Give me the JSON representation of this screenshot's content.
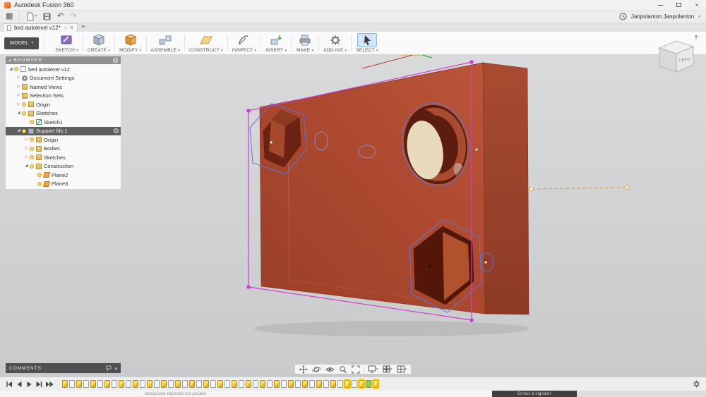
{
  "window": {
    "title": "Autodesk Fusion 360"
  },
  "glyphs": {
    "caret": "▾",
    "caret_up": "▴",
    "close": "×",
    "plus": "+",
    "sync": "○",
    "undo": "↶",
    "redo": "↷",
    "grid_menu": "▦",
    "collapse": "«",
    "expanded": "◢",
    "collapsed": "▷"
  },
  "user": {
    "name": "Janpolanton Janpolanton"
  },
  "tab": {
    "title": "bed autolevel v12*"
  },
  "ribbon": {
    "model_label": "MODEL",
    "groups": [
      {
        "key": "sketch",
        "label": "SKETCH"
      },
      {
        "key": "create",
        "label": "CREATE"
      },
      {
        "key": "modify",
        "label": "MODIFY"
      },
      {
        "key": "assemble",
        "label": "ASSEMBLE"
      },
      {
        "key": "construct",
        "label": "CONSTRUCT"
      },
      {
        "key": "inspect",
        "label": "INSPECT"
      },
      {
        "key": "insert",
        "label": "INSERT"
      },
      {
        "key": "make",
        "label": "MAKE"
      },
      {
        "key": "addins",
        "label": "ADD-INS"
      },
      {
        "key": "select",
        "label": "SELECT",
        "highlight": true
      }
    ]
  },
  "browser": {
    "header": "BROWSER",
    "items": [
      {
        "level": 0,
        "label": "bed autolevel v12",
        "icon": "doc",
        "arrow": "expanded",
        "bulb": true
      },
      {
        "level": 1,
        "label": "Document Settings",
        "icon": "gear",
        "arrow": "collapsed"
      },
      {
        "level": 1,
        "label": "Named Views",
        "icon": "folder",
        "arrow": "collapsed"
      },
      {
        "level": 1,
        "label": "Selection Sets",
        "icon": "folder",
        "arrow": "collapsed"
      },
      {
        "level": 1,
        "label": "Origin",
        "icon": "folder",
        "arrow": "collapsed",
        "bulb": true
      },
      {
        "level": 1,
        "label": "Sketches",
        "icon": "folder",
        "arrow": "expanded",
        "bulb": true
      },
      {
        "level": 2,
        "label": "Sketch1",
        "icon": "sketch",
        "bulb": true
      },
      {
        "level": 1,
        "label": "Support fdc:1",
        "icon": "component",
        "arrow": "expanded",
        "bulb": true,
        "selected": true,
        "badge": true
      },
      {
        "level": 2,
        "label": "Origin",
        "icon": "folder",
        "arrow": "collapsed",
        "bulb": true
      },
      {
        "level": 2,
        "label": "Bodies",
        "icon": "folder",
        "arrow": "collapsed",
        "bulb": true
      },
      {
        "level": 2,
        "label": "Sketches",
        "icon": "folder",
        "arrow": "collapsed",
        "bulb": true
      },
      {
        "level": 2,
        "label": "Construction",
        "icon": "folder",
        "arrow": "expanded",
        "bulb": true
      },
      {
        "level": 3,
        "label": "Plane2",
        "icon": "plane",
        "bulb": true
      },
      {
        "level": 3,
        "label": "Plane3",
        "icon": "plane",
        "bulb": true
      }
    ]
  },
  "viewcube": {
    "face": "LEFT"
  },
  "comments": {
    "label": "COMMENTS"
  },
  "timeline": {
    "pattern": "sfsfsfsfsfsfsfsfsfsfsfsfsfsfsfsfsfsfsfsfhfhgh"
  },
  "bottom_strip": {
    "left_text": "lorsqu'une réponse est postée",
    "right_text": "Erreur à signaler"
  },
  "colors": {
    "body_red": "#b04a32",
    "selection_magenta": "#cf3ecf",
    "sketch_blue": "#5b79d6",
    "construction_orange": "#e09a3a",
    "select_highlight": "#d2e7f8"
  }
}
